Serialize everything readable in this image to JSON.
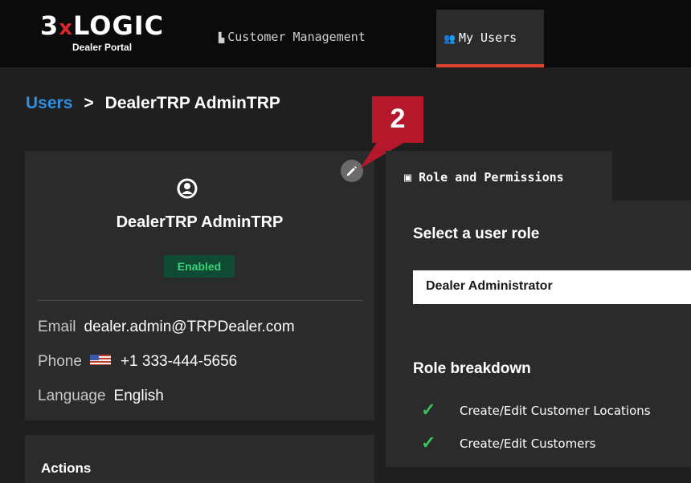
{
  "brand": {
    "name_pre": "3",
    "name_x": "x",
    "name_post": "LOGIC",
    "subtitle": "Dealer Portal"
  },
  "nav": {
    "customer_management": "Customer Management",
    "my_users": "My Users"
  },
  "breadcrumb": {
    "parent": "Users",
    "separator": ">",
    "current": "DealerTRP AdminTRP"
  },
  "callout": {
    "number": "2"
  },
  "profile": {
    "name": "DealerTRP AdminTRP",
    "status": "Enabled",
    "email_label": "Email",
    "email": "dealer.admin@TRPDealer.com",
    "phone_label": "Phone",
    "phone": "+1 333-444-5656",
    "language_label": "Language",
    "language": "English"
  },
  "actions": {
    "title": "Actions"
  },
  "roles": {
    "tab_label": "Role and Permissions",
    "select_title": "Select a user role",
    "selected_role": "Dealer Administrator",
    "breakdown_title": "Role breakdown",
    "permissions": [
      "Create/Edit Customer Locations",
      "Create/Edit Customers"
    ]
  },
  "colors": {
    "accent": "#e0422f",
    "link": "#2f8fe0",
    "callout": "#b5172b",
    "enabled": "#3fd07a",
    "check": "#34c759"
  }
}
